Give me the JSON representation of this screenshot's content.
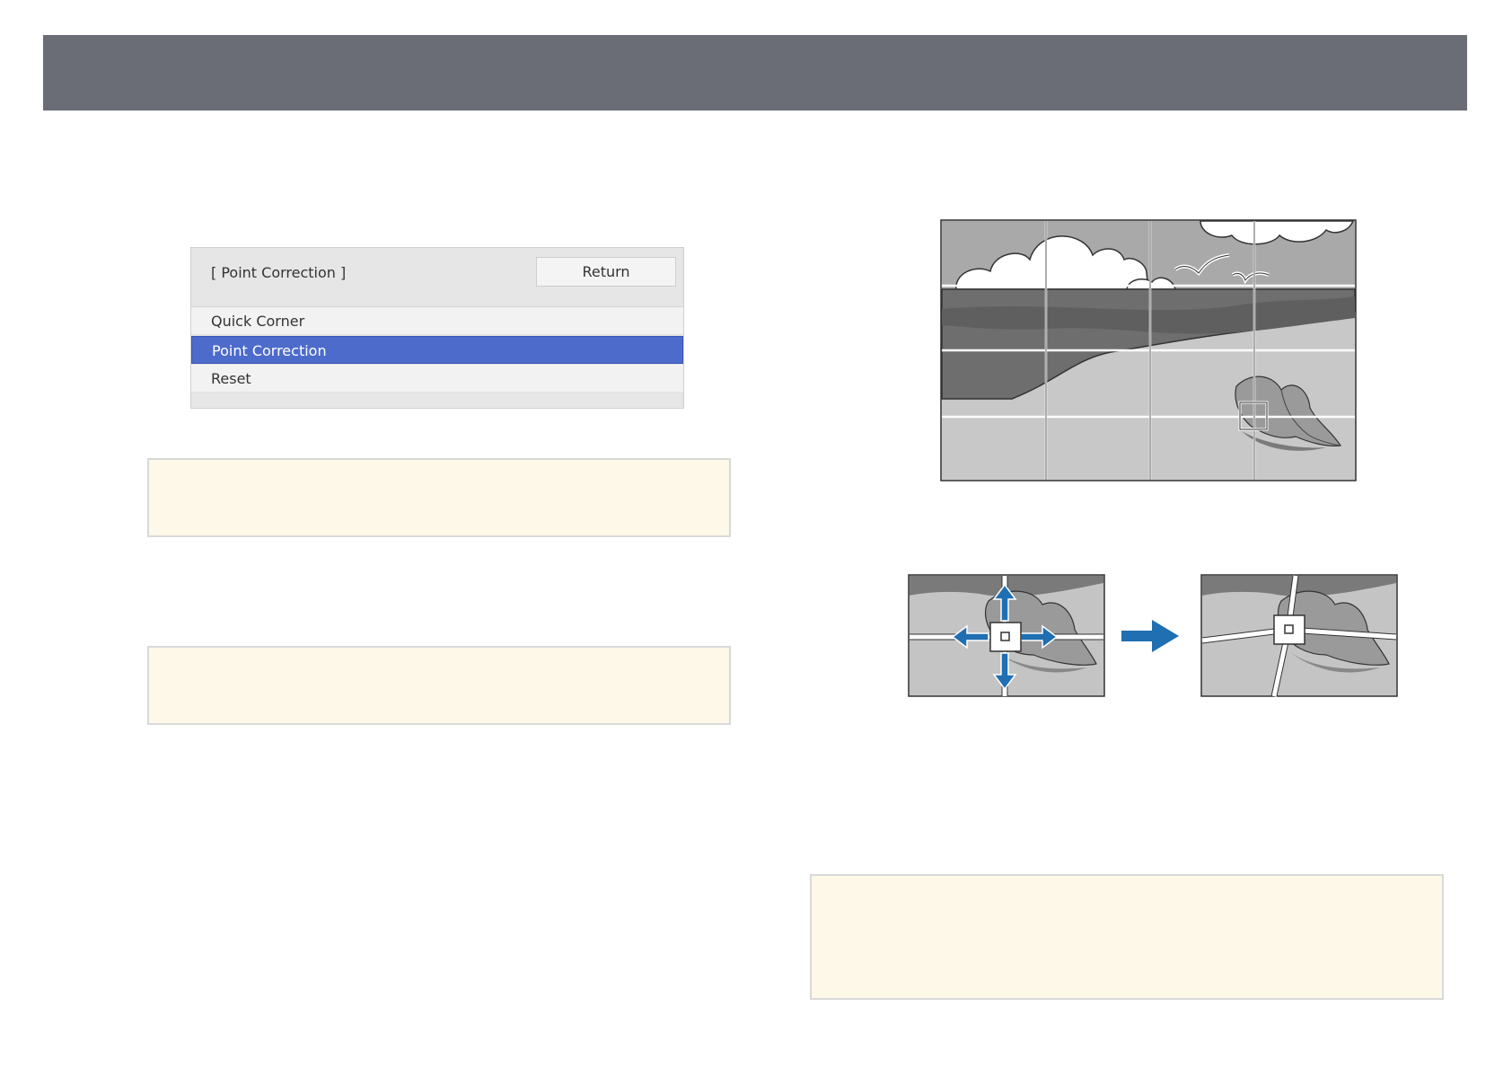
{
  "menu": {
    "title": "[ Point Correction ]",
    "return_label": "Return",
    "items": [
      {
        "label": "Quick Corner",
        "selected": false
      },
      {
        "label": "Point Correction",
        "selected": true
      },
      {
        "label": "Reset",
        "selected": false
      }
    ]
  },
  "colors": {
    "header_bar": "#6a6d76",
    "selection": "#4d6bcb",
    "note_background": "#fdf8e7",
    "arrow": "#1f6fb2"
  },
  "icons": [
    "arrow-up-icon",
    "arrow-down-icon",
    "arrow-left-icon",
    "arrow-right-icon",
    "arrow-right-large-icon"
  ]
}
